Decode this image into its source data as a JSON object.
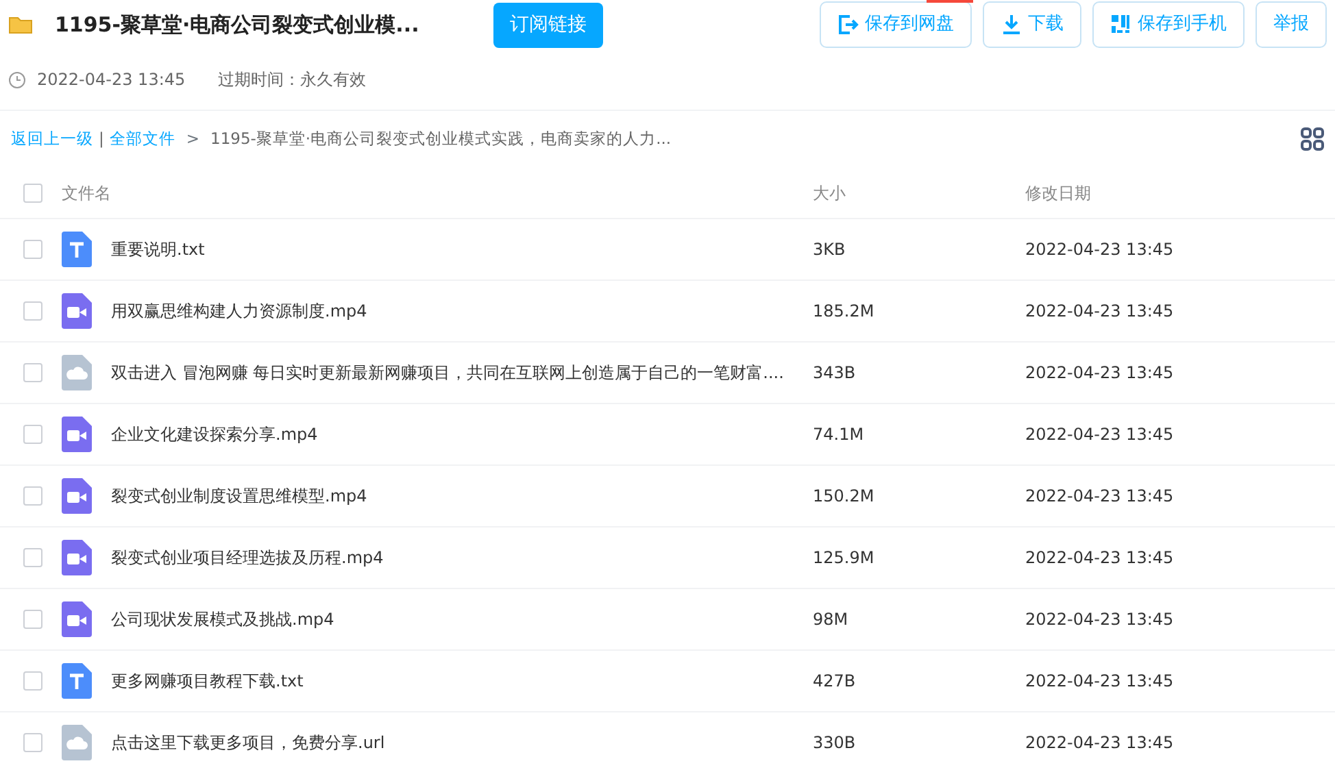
{
  "share": {
    "title": "1195-聚草堂·电商公司裂变式创业模...",
    "subscribe_button": "订阅链接",
    "time": "2022-04-23 13:45",
    "expiry": "过期时间：永久有效"
  },
  "actions": [
    {
      "label": "保存到网盘",
      "kind": "save"
    },
    {
      "label": "下载",
      "kind": "download"
    },
    {
      "label": "保存到手机",
      "kind": "phone"
    },
    {
      "label": "举报",
      "kind": "report"
    }
  ],
  "breadcrumb": {
    "back": "返回上一级",
    "separator": "|",
    "root": "全部文件",
    "arrow": ">",
    "current": "1195-聚草堂·电商公司裂变式创业模式实践，电商卖家的人力..."
  },
  "table": {
    "select_all_checked": false,
    "columns": [
      "文件名",
      "大小",
      "修改日期"
    ],
    "rows": [
      {
        "kind": "txt",
        "name": "重要说明.txt",
        "size": "3KB",
        "date": "2022-04-23 13:45",
        "checked": false
      },
      {
        "kind": "video",
        "name": "用双赢思维构建人力资源制度.mp4",
        "size": "185.2M",
        "date": "2022-04-23 13:45",
        "checked": false
      },
      {
        "kind": "link",
        "name": "双击进入 冒泡网赚 每日实时更新最新网赚项目，共同在互联网上创造属于自己的一笔财富....",
        "size": "343B",
        "date": "2022-04-23 13:45",
        "checked": false
      },
      {
        "kind": "video",
        "name": "企业文化建设探索分享.mp4",
        "size": "74.1M",
        "date": "2022-04-23 13:45",
        "checked": false
      },
      {
        "kind": "video",
        "name": "裂变式创业制度设置思维模型.mp4",
        "size": "150.2M",
        "date": "2022-04-23 13:45",
        "checked": false
      },
      {
        "kind": "video",
        "name": "裂变式创业项目经理选拔及历程.mp4",
        "size": "125.9M",
        "date": "2022-04-23 13:45",
        "checked": false
      },
      {
        "kind": "video",
        "name": "公司现状发展模式及挑战.mp4",
        "size": "98M",
        "date": "2022-04-23 13:45",
        "checked": false
      },
      {
        "kind": "txt",
        "name": "更多网赚项目教程下载.txt",
        "size": "427B",
        "date": "2022-04-23 13:45",
        "checked": false
      },
      {
        "kind": "link",
        "name": "点击这里下载更多项目，免费分享.url",
        "size": "330B",
        "date": "2022-04-23 13:45",
        "checked": false
      }
    ]
  }
}
